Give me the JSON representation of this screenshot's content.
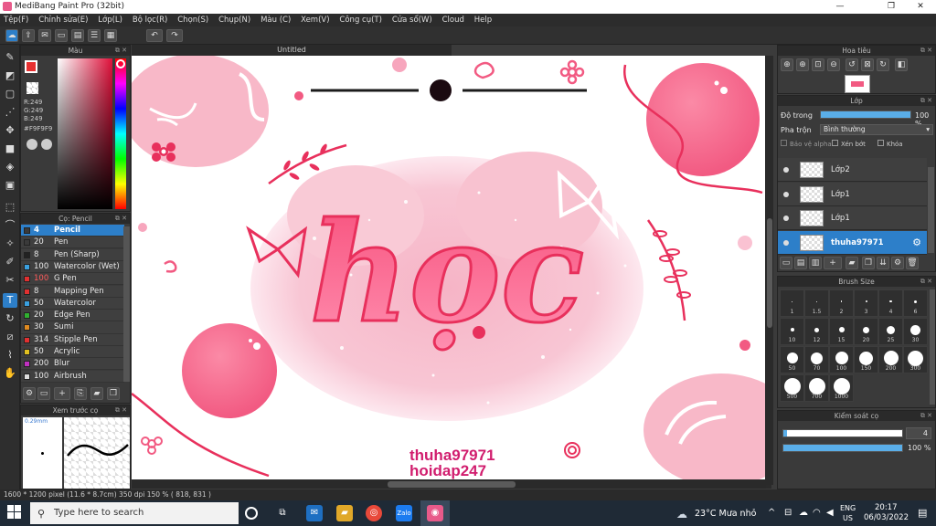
{
  "window": {
    "title": "MediBang Paint Pro (32bit)",
    "minimize": "—",
    "maximize": "❐",
    "close": "✕"
  },
  "menu": [
    "Tệp(F)",
    "Chỉnh sửa(E)",
    "Lớp(L)",
    "Bộ lọc(R)",
    "Chọn(S)",
    "Chụp(N)",
    "Màu (C)",
    "Xem(V)",
    "Công cụ(T)",
    "Cửa sổ(W)",
    "Cloud",
    "Help"
  ],
  "color_panel": {
    "title": "Màu",
    "r": "R:249",
    "g": "G:249",
    "b": "B:249",
    "hex": "#F9F9F9"
  },
  "brush_panel": {
    "title": "Cọ: Pencil",
    "items": [
      {
        "size": "4",
        "name": "Pencil",
        "color": "#3a3a3a"
      },
      {
        "size": "20",
        "name": "Pen",
        "color": "#3a3a3a"
      },
      {
        "size": "8",
        "name": "Pen (Sharp)",
        "color": "#222222"
      },
      {
        "size": "100",
        "name": "Watercolor (Wet)",
        "color": "#3aa0e0"
      },
      {
        "size": "100",
        "name": "G Pen",
        "color": "#e03030"
      },
      {
        "size": "8",
        "name": "Mapping Pen",
        "color": "#e03030"
      },
      {
        "size": "50",
        "name": "Watercolor",
        "color": "#3aa0e0"
      },
      {
        "size": "20",
        "name": "Edge Pen",
        "color": "#30b030"
      },
      {
        "size": "30",
        "name": "Sumi",
        "color": "#e08a20"
      },
      {
        "size": "314",
        "name": "Stipple Pen",
        "color": "#e03030"
      },
      {
        "size": "50",
        "name": "Acrylic",
        "color": "#e0c020"
      },
      {
        "size": "200",
        "name": "Blur",
        "color": "#c030c0"
      },
      {
        "size": "100",
        "name": "Airbrush",
        "color": "#dddddd"
      }
    ]
  },
  "preview_panel": {
    "title": "Xem trước cọ",
    "size_label": "0.29mm"
  },
  "document": {
    "tab": "Untitled"
  },
  "canvas_art": {
    "word": "học",
    "watermark1": "thuha97971",
    "watermark2": "hoidap247"
  },
  "navigator": {
    "title": "Hoa tiêu"
  },
  "layer_panel": {
    "title": "Lớp",
    "opacity_label": "Độ trong",
    "opacity_value": "100 %",
    "opacity_fraction": 1.0,
    "blend_label": "Pha trộn",
    "blend_value": "Bình thường",
    "protect_alpha": "Bảo vệ alpha",
    "clipping": "Xén bớt",
    "lock": "Khóa",
    "layers": [
      {
        "name": "Lớp2",
        "selected": false
      },
      {
        "name": "Lớp1",
        "selected": false
      },
      {
        "name": "Lớp1",
        "selected": false
      },
      {
        "name": "thuha97971",
        "selected": true
      }
    ]
  },
  "brush_size_panel": {
    "title": "Brush Size",
    "sizes": [
      "1",
      "1.5",
      "2",
      "3",
      "4",
      "6",
      "10",
      "12",
      "15",
      "20",
      "25",
      "30",
      "50",
      "70",
      "100",
      "150",
      "200",
      "300",
      "500",
      "700",
      "1000"
    ]
  },
  "brush_control": {
    "title": "Kiểm soát cọ",
    "size_value": "4",
    "opacity_value": "100 %",
    "opacity_fraction": 1.0
  },
  "status": {
    "text": "1600 * 1200 pixel   (11.6 * 8.7cm)   350 dpi   150 %   ( 818, 831 )"
  },
  "taskbar": {
    "search_placeholder": "Type here to search",
    "weather": "23°C  Mưa nhỏ",
    "lang1": "ENG",
    "lang2": "US",
    "time": "20:17",
    "date": "06/03/2022"
  },
  "colors": {
    "accent": "#2d7fc9",
    "pink": "#f0507a",
    "lightpink": "#f9b6c6"
  }
}
